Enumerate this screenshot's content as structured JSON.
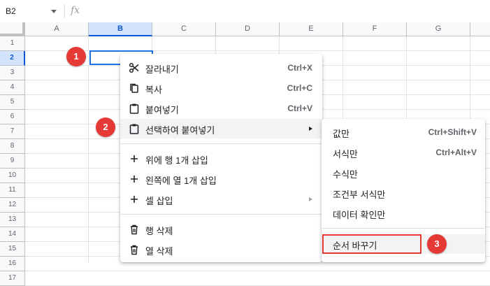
{
  "formula_bar": {
    "cell_ref": "B2",
    "fx_label": "fx"
  },
  "columns": [
    "A",
    "B",
    "C",
    "D",
    "E",
    "F",
    "G"
  ],
  "selected_column": "B",
  "rows": [
    "1",
    "2",
    "3",
    "4",
    "5",
    "6",
    "7",
    "8",
    "9",
    "10",
    "11",
    "12",
    "13",
    "14",
    "15",
    "16",
    "17"
  ],
  "selected_row": "2",
  "context_menu": {
    "cut": {
      "label": "잘라내기",
      "shortcut": "Ctrl+X",
      "icon": "scissors-icon"
    },
    "copy": {
      "label": "복사",
      "shortcut": "Ctrl+C",
      "icon": "copy-icon"
    },
    "paste": {
      "label": "붙여넣기",
      "shortcut": "Ctrl+V",
      "icon": "clipboard-icon"
    },
    "paste_special": {
      "label": "선택하여 붙여넣기",
      "icon": "clipboard-icon"
    },
    "insert_row_above": {
      "label": "위에 행 1개 삽입",
      "icon": "plus-icon"
    },
    "insert_col_left": {
      "label": "왼쪽에 열 1개 삽입",
      "icon": "plus-icon"
    },
    "insert_cells": {
      "label": "셀 삽입",
      "icon": "plus-icon"
    },
    "delete_row": {
      "label": "행 삭제",
      "icon": "trash-icon"
    },
    "delete_col": {
      "label": "열 삭제",
      "icon": "trash-icon"
    }
  },
  "paste_special_submenu": {
    "values_only": {
      "label": "값만",
      "shortcut": "Ctrl+Shift+V"
    },
    "format_only": {
      "label": "서식만",
      "shortcut": "Ctrl+Alt+V"
    },
    "formula_only": {
      "label": "수식만"
    },
    "conditional_format_only": {
      "label": "조건부 서식만"
    },
    "data_validation_only": {
      "label": "데이터 확인만"
    },
    "transposed": {
      "label": "순서 바꾸기"
    }
  },
  "step_badges": [
    "1",
    "2",
    "3"
  ],
  "colors": {
    "accent": "#1a73e8",
    "badge": "#e53935",
    "header_selected": "#d3e3fd"
  }
}
